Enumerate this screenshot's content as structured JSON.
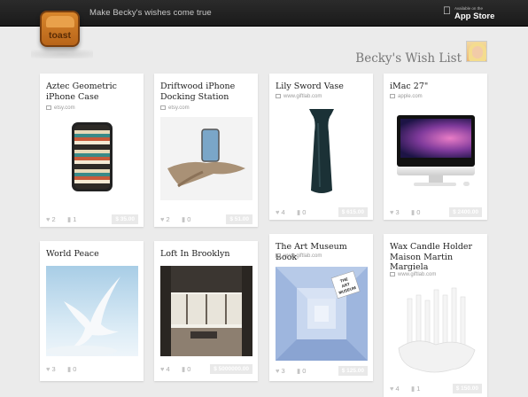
{
  "header": {
    "logo_text": "toast",
    "tagline": "Make Becky's wishes come true",
    "app_store": {
      "small": "Available on the",
      "big": "App Store"
    }
  },
  "wishlist": {
    "title": "Becky's Wish List"
  },
  "items": [
    {
      "title": "Aztec Geometric iPhone Case",
      "source": "etsy.com",
      "likes": "2",
      "comments": "1",
      "price": "$ 35.00"
    },
    {
      "title": "Driftwood iPhone Docking Station",
      "source": "etsy.com",
      "likes": "2",
      "comments": "0",
      "price": "$ 51.00"
    },
    {
      "title": "Lily Sword Vase",
      "source": "www.giftlab.com",
      "likes": "4",
      "comments": "0",
      "price": "$ 615.00"
    },
    {
      "title": "iMac 27\"",
      "source": "apple.com",
      "likes": "3",
      "comments": "0",
      "price": "$ 2400.00"
    },
    {
      "title": "World Peace",
      "source": "",
      "likes": "3",
      "comments": "0",
      "price": ""
    },
    {
      "title": "Loft In Brooklyn",
      "source": "",
      "likes": "4",
      "comments": "0",
      "price": "$ 5000000.00"
    },
    {
      "title": "The Art Museum Book",
      "source": "www.giftlab.com",
      "likes": "3",
      "comments": "0",
      "price": "$ 125.00"
    },
    {
      "title": "Wax Candle Holder Maison Martin Margiela",
      "source": "www.giftlab.com",
      "likes": "4",
      "comments": "1",
      "price": "$ 150.00"
    }
  ],
  "book_cover": {
    "line1": "THE",
    "line2": "ART",
    "line3": "MUSEUM"
  },
  "icons": {
    "like": "heart-icon",
    "comment": "comment-bubble-icon",
    "source": "monitor-icon",
    "apple": "apple-logo-icon"
  },
  "colors": {
    "topbar": "#1f1f1f",
    "logo": "#c8762a",
    "page_bg": "#ebebeb",
    "card_bg": "#ffffff"
  }
}
